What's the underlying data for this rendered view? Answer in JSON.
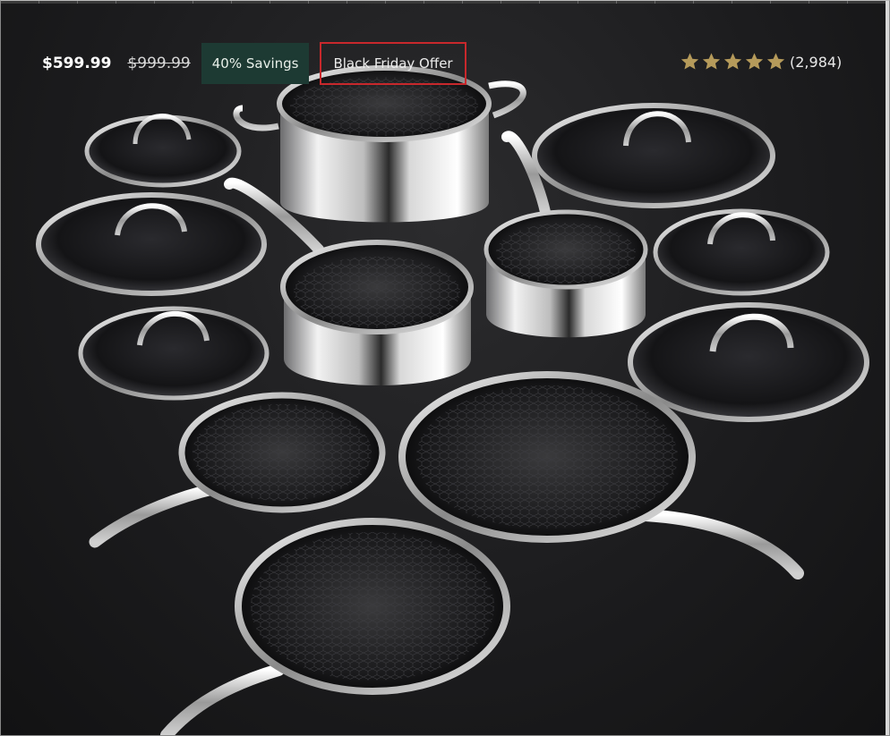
{
  "pricing": {
    "current_price": "$599.99",
    "original_price": "$999.99",
    "savings_badge": "40% Savings",
    "offer_badge": "Black Friday Offer"
  },
  "rating": {
    "stars": 5,
    "review_count": "(2,984)",
    "star_color": "#b59a5a"
  },
  "colors": {
    "savings_badge_bg": "#1d3a33",
    "offer_badge_border": "#c8282c",
    "background": "#1c1c1e"
  },
  "product_image": {
    "icon": "cookware-set-image"
  }
}
